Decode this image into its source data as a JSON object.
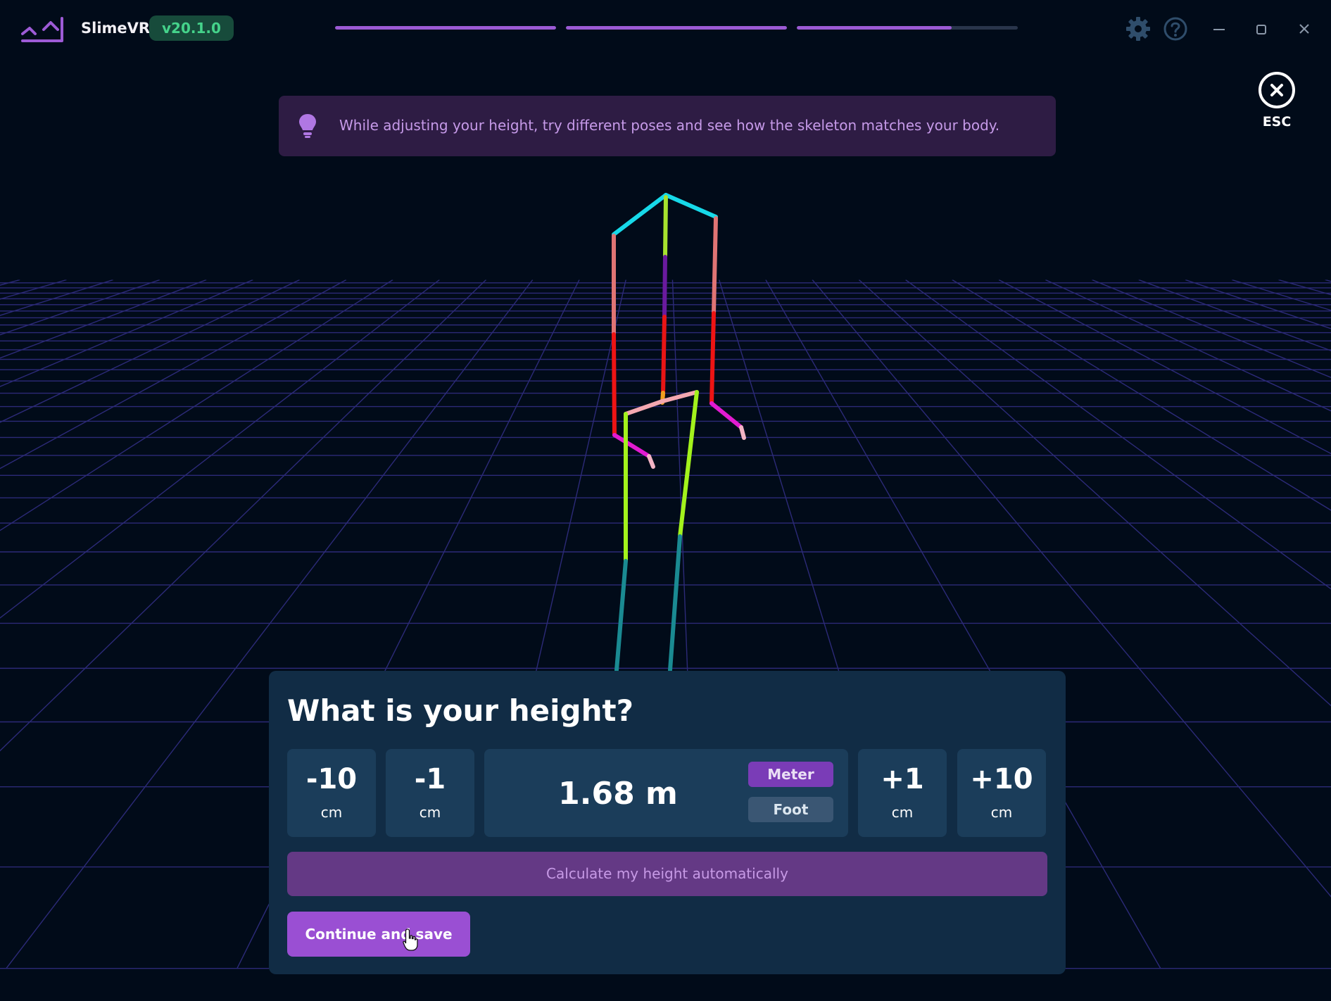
{
  "app": {
    "name": "SlimeVR",
    "version": "v20.1.0"
  },
  "progress": [
    1.0,
    1.0,
    0.7
  ],
  "esc": {
    "label": "ESC"
  },
  "tip": {
    "text": "While adjusting your height, try different poses and see how the skeleton matches your body."
  },
  "height": {
    "title": "What is your height?",
    "value": "1.68 m",
    "steps": [
      {
        "value": "-10",
        "unit": "cm"
      },
      {
        "value": "-1",
        "unit": "cm"
      },
      {
        "value": "+1",
        "unit": "cm"
      },
      {
        "value": "+10",
        "unit": "cm"
      }
    ],
    "units": {
      "meter": "Meter",
      "foot": "Foot",
      "selected": "meter"
    },
    "auto_label": "Calculate my height automatically",
    "save_label": "Continue and save"
  },
  "colors": {
    "background": "#010b19",
    "accent": "#9a4fd3",
    "grid": "#2c2a78",
    "version_badge": "#174b3b",
    "version_text": "#45d38b"
  },
  "icons": [
    "slimevr-logo",
    "settings-gear-icon",
    "help-icon",
    "minimize-icon",
    "maximize-icon",
    "close-icon",
    "lightbulb-icon",
    "close-circle-icon",
    "pointer-cursor-icon"
  ]
}
